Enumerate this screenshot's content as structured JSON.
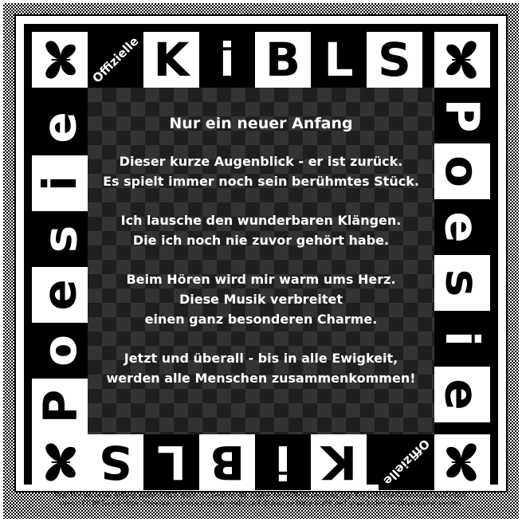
{
  "header": {
    "badge": "Offizielle",
    "letters": [
      "K",
      "i",
      "B",
      "L",
      "S"
    ]
  },
  "side_word": [
    "P",
    "o",
    "e",
    "s",
    "i",
    "e"
  ],
  "poem": {
    "title": "Nur ein neuer Anfang",
    "stanzas": [
      [
        "Dieser kurze Augenblick - er ist zurück.",
        "Es spielt immer noch sein berühmtes Stück."
      ],
      [
        "Ich lausche den wunderbaren Klängen.",
        "Die ich noch nie zuvor gehört habe."
      ],
      [
        "Beim Hören wird mir warm ums Herz.",
        "Diese Musik verbreitet",
        "einen ganz besonderen Charme."
      ],
      [
        "Jetzt und überall - bis in alle Ewigkeit,",
        "werden alle Menschen zusammenkommen!"
      ]
    ]
  },
  "caption": {
    "line1": "Titel: Nur ein neuer Anfang, Autor: KiBLS, Buch: 02, Gedicht: 40, Quelle: https://kibls.neocities.org/ Alle Lizenzbestimmungen sind erfüllt.",
    "line2": "Lizenz: CC BY-SA 4.0 https://creativecommons.org/licenses/by-sa/4.0/deed.de Diese Grafik darf unverändert weiterverbreitet werden."
  },
  "colors": {
    "background": "#000000",
    "paper": "#ffffff",
    "text": "#ffffff"
  },
  "icons": [
    "butterfly-icon"
  ]
}
